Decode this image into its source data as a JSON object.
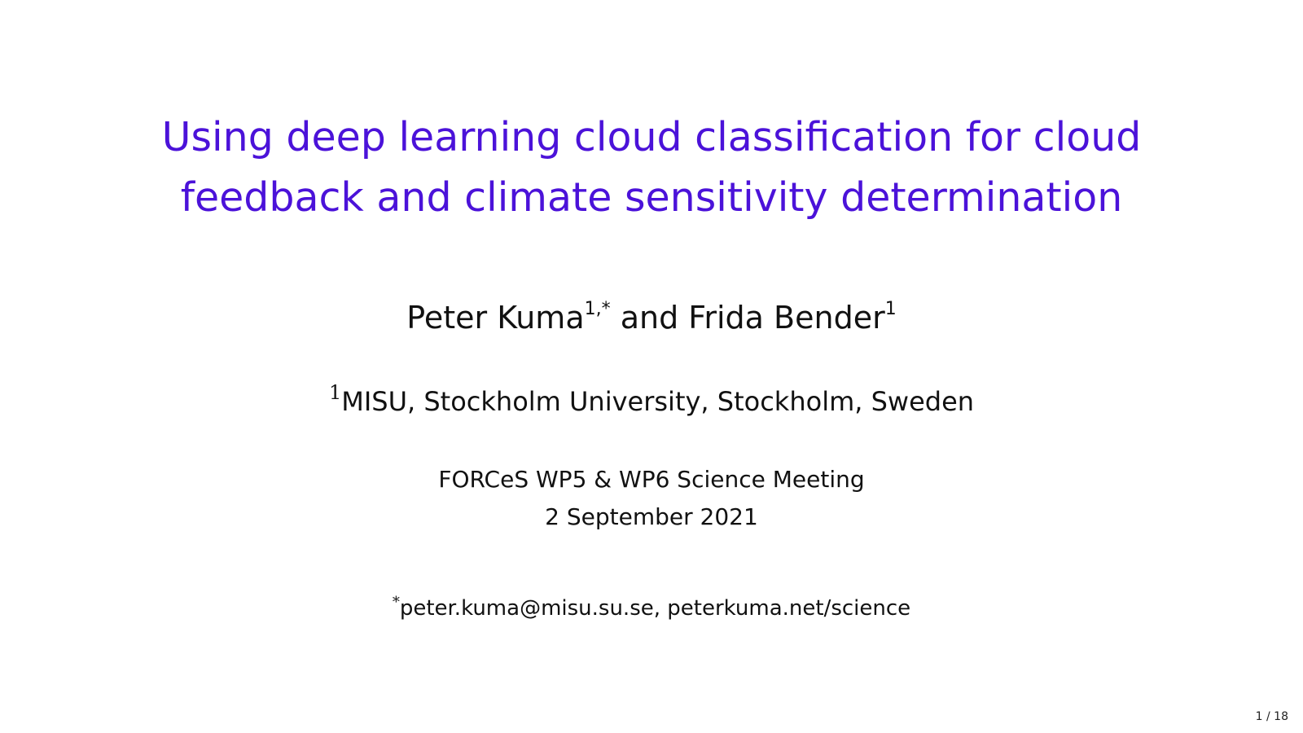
{
  "slide": {
    "title_line1": "Using deep learning cloud classification for cloud",
    "title_line2": "feedback and climate sensitivity determination",
    "author1": "Peter Kuma",
    "author1_marks": "1,*",
    "and": " and ",
    "author2": "Frida Bender",
    "author2_marks": "1",
    "affiliation_mark": "1",
    "affiliation": "MISU, Stockholm University, Stockholm, Sweden",
    "meeting": "FORCeS WP5 & WP6 Science Meeting",
    "date": "2 September 2021",
    "contact_mark": "*",
    "contact": "peter.kuma@misu.su.se, peterkuma.net/science",
    "page_indicator": "1 / 18",
    "accent_color": "#4b12d9"
  }
}
